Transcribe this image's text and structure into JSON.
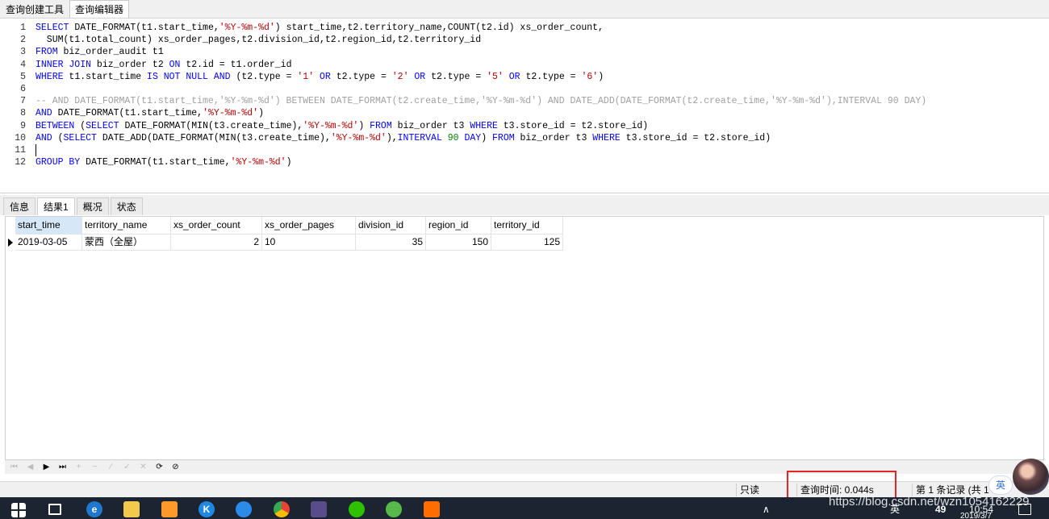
{
  "top_tabs": [
    {
      "label": "查询创建工具"
    },
    {
      "label": "查询编辑器"
    }
  ],
  "editor": {
    "lines": [
      {
        "n": "1",
        "tokens": [
          {
            "t": "SELECT",
            "c": "kw"
          },
          {
            "t": " DATE_FORMAT(t1.start_time,",
            "c": "plain"
          },
          {
            "t": "'%Y-%m-%d'",
            "c": "str"
          },
          {
            "t": ") start_time,t2.territory_name,COUNT(t2.id) xs_order_count,",
            "c": "plain"
          }
        ]
      },
      {
        "n": "2",
        "tokens": [
          {
            "t": "  SUM(t1.total_count) xs_order_pages,t2.division_id,t2.region_id,t2.territory_id",
            "c": "plain"
          }
        ]
      },
      {
        "n": "3",
        "tokens": [
          {
            "t": "FROM",
            "c": "kw"
          },
          {
            "t": " biz_order_audit t1",
            "c": "plain"
          }
        ]
      },
      {
        "n": "4",
        "tokens": [
          {
            "t": "INNER JOIN",
            "c": "kw"
          },
          {
            "t": " biz_order t2 ",
            "c": "plain"
          },
          {
            "t": "ON",
            "c": "kw"
          },
          {
            "t": " t2.id = t1.order_id",
            "c": "plain"
          }
        ]
      },
      {
        "n": "5",
        "tokens": [
          {
            "t": "WHERE",
            "c": "kw"
          },
          {
            "t": " t1.start_time ",
            "c": "plain"
          },
          {
            "t": "IS NOT NULL AND",
            "c": "kw"
          },
          {
            "t": " (t2.type = ",
            "c": "plain"
          },
          {
            "t": "'1'",
            "c": "str"
          },
          {
            "t": " ",
            "c": "plain"
          },
          {
            "t": "OR",
            "c": "kw"
          },
          {
            "t": " t2.type = ",
            "c": "plain"
          },
          {
            "t": "'2'",
            "c": "str"
          },
          {
            "t": " ",
            "c": "plain"
          },
          {
            "t": "OR",
            "c": "kw"
          },
          {
            "t": " t2.type = ",
            "c": "plain"
          },
          {
            "t": "'5'",
            "c": "str"
          },
          {
            "t": " ",
            "c": "plain"
          },
          {
            "t": "OR",
            "c": "kw"
          },
          {
            "t": " t2.type = ",
            "c": "plain"
          },
          {
            "t": "'6'",
            "c": "str"
          },
          {
            "t": ")",
            "c": "plain"
          }
        ]
      },
      {
        "n": "6",
        "tokens": []
      },
      {
        "n": "7",
        "tokens": [
          {
            "t": "-- AND DATE_FORMAT(t1.start_time,'%Y-%m-%d') BETWEEN DATE_FORMAT(t2.create_time,'%Y-%m-%d') AND DATE_ADD(DATE_FORMAT(t2.create_time,'%Y-%m-%d'),INTERVAL 90 DAY)",
            "c": "cmt"
          }
        ]
      },
      {
        "n": "8",
        "tokens": [
          {
            "t": "AND",
            "c": "kw"
          },
          {
            "t": " DATE_FORMAT(t1.start_time,",
            "c": "plain"
          },
          {
            "t": "'%Y-%m-%d'",
            "c": "str"
          },
          {
            "t": ")",
            "c": "plain"
          }
        ]
      },
      {
        "n": "9",
        "tokens": [
          {
            "t": "BETWEEN",
            "c": "kw"
          },
          {
            "t": " (",
            "c": "plain"
          },
          {
            "t": "SELECT",
            "c": "kw"
          },
          {
            "t": " DATE_FORMAT(MIN(t3.create_time),",
            "c": "plain"
          },
          {
            "t": "'%Y-%m-%d'",
            "c": "str"
          },
          {
            "t": ") ",
            "c": "plain"
          },
          {
            "t": "FROM",
            "c": "kw"
          },
          {
            "t": " biz_order t3 ",
            "c": "plain"
          },
          {
            "t": "WHERE",
            "c": "kw"
          },
          {
            "t": " t3.store_id = t2.store_id)",
            "c": "plain"
          }
        ]
      },
      {
        "n": "10",
        "tokens": [
          {
            "t": "AND",
            "c": "kw"
          },
          {
            "t": " (",
            "c": "plain"
          },
          {
            "t": "SELECT",
            "c": "kw"
          },
          {
            "t": " DATE_ADD(DATE_FORMAT(MIN(t3.create_time),",
            "c": "plain"
          },
          {
            "t": "'%Y-%m-%d'",
            "c": "str"
          },
          {
            "t": "),",
            "c": "plain"
          },
          {
            "t": "INTERVAL",
            "c": "kw"
          },
          {
            "t": " ",
            "c": "plain"
          },
          {
            "t": "90",
            "c": "num"
          },
          {
            "t": " ",
            "c": "plain"
          },
          {
            "t": "DAY",
            "c": "kw"
          },
          {
            "t": ") ",
            "c": "plain"
          },
          {
            "t": "FROM",
            "c": "kw"
          },
          {
            "t": " biz_order t3 ",
            "c": "plain"
          },
          {
            "t": "WHERE",
            "c": "kw"
          },
          {
            "t": " t3.store_id = t2.store_id)",
            "c": "plain"
          }
        ]
      },
      {
        "n": "11",
        "tokens": []
      },
      {
        "n": "12",
        "tokens": [
          {
            "t": "GROUP BY",
            "c": "kw"
          },
          {
            "t": " DATE_FORMAT(t1.start_time,",
            "c": "plain"
          },
          {
            "t": "'%Y-%m-%d'",
            "c": "str"
          },
          {
            "t": ")",
            "c": "plain"
          }
        ]
      }
    ]
  },
  "result_tabs": [
    {
      "label": "信息"
    },
    {
      "label": "结果1"
    },
    {
      "label": "概况"
    },
    {
      "label": "状态"
    }
  ],
  "grid": {
    "columns": [
      "start_time",
      "territory_name",
      "xs_order_count",
      "xs_order_pages",
      "division_id",
      "region_id",
      "territory_id"
    ],
    "rows": [
      [
        "2019-03-05",
        "蒙西（全屋）",
        "2",
        "10",
        "35",
        "150",
        "125"
      ]
    ]
  },
  "status": {
    "readonly": "只读",
    "query_time": "查询时间: 0.044s",
    "record": "第 1 条记录 (共 1"
  },
  "ime_label": "英",
  "taskbar": {
    "tray_text": "英",
    "number": "49",
    "clock": "10:54",
    "date": "2019/3/7"
  },
  "watermark": "https://blog.csdn.net/wzn1054162229",
  "colors": {
    "keyword": "#0000ff",
    "string": "#c00000",
    "number": "#008000",
    "comment": "#a0a0a0",
    "highlight_box": "#e52525",
    "taskbar": "#1b2430"
  }
}
